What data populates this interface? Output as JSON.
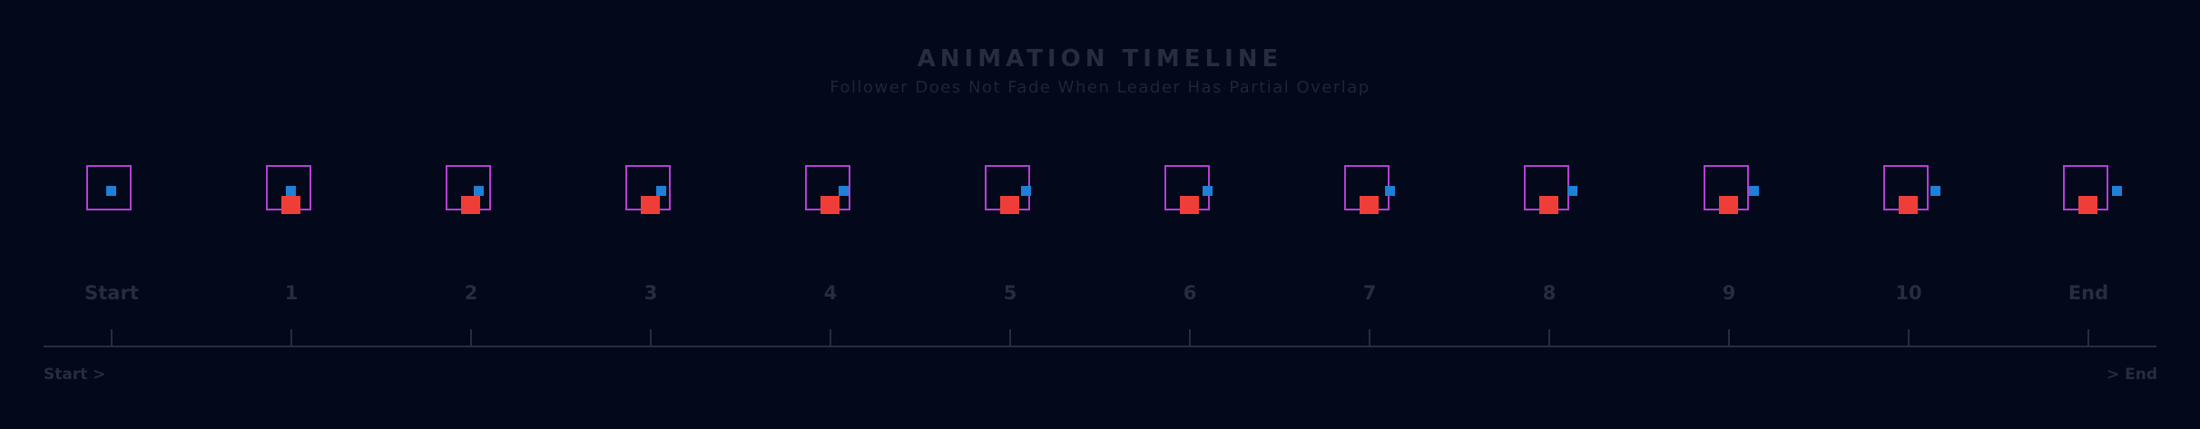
{
  "title": "ANIMATION TIMELINE",
  "subtitle": "Follower Does Not Fade When Leader Has Partial Overlap",
  "frames": [
    {
      "label": "Start",
      "leader_visible": false
    },
    {
      "label": "1",
      "leader_visible": true
    },
    {
      "label": "2",
      "leader_visible": true
    },
    {
      "label": "3",
      "leader_visible": true
    },
    {
      "label": "4",
      "leader_visible": true
    },
    {
      "label": "5",
      "leader_visible": true
    },
    {
      "label": "6",
      "leader_visible": true
    },
    {
      "label": "7",
      "leader_visible": true
    },
    {
      "label": "8",
      "leader_visible": true
    },
    {
      "label": "9",
      "leader_visible": true
    },
    {
      "label": "10",
      "leader_visible": true
    },
    {
      "label": "End",
      "leader_visible": true
    }
  ],
  "axis": {
    "start_label": "Start >",
    "end_label": "> End"
  },
  "colors": {
    "frame": "#b53fd6",
    "follower": "#1f80d8",
    "leader": "#ef3e38",
    "text": "#262d3e",
    "background": "#03081a"
  }
}
